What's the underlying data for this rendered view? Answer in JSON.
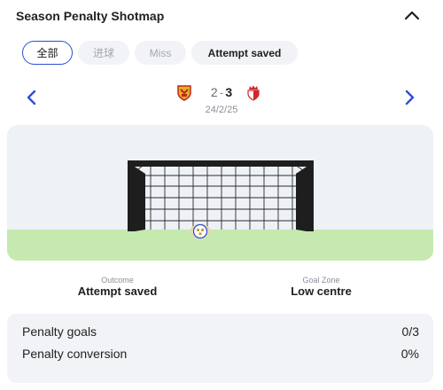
{
  "header": {
    "title": "Season Penalty Shotmap",
    "collapse_icon": "chevron-up-icon"
  },
  "filters": [
    {
      "label": "全部",
      "active": true
    },
    {
      "label": "进球",
      "active": false
    },
    {
      "label": "Miss",
      "active": false
    },
    {
      "label": "Attempt saved",
      "active": false
    }
  ],
  "match": {
    "home_crest": "rc-lens-crest-icon",
    "away_crest": "as-monaco-crest-icon",
    "home_score": "2",
    "away_score": "3",
    "separator": "-",
    "date": "24/2/25",
    "prev_icon": "chevron-left-icon",
    "next_icon": "chevron-right-icon"
  },
  "shot": {
    "ball_icon": "football-icon",
    "outcome_label": "Outcome",
    "outcome_value": "Attempt saved",
    "zone_label": "Goal Zone",
    "zone_value": "Low centre"
  },
  "stats": [
    {
      "label": "Penalty goals",
      "value": "0/3"
    },
    {
      "label": "Penalty conversion",
      "value": "0%"
    }
  ],
  "colors": {
    "accent": "#2d4fd4",
    "grass": "#c6e9b0",
    "pitch_bg": "#eef1f6",
    "card_bg": "#f2f3f6",
    "goal_frame": "#1e1e1e"
  }
}
